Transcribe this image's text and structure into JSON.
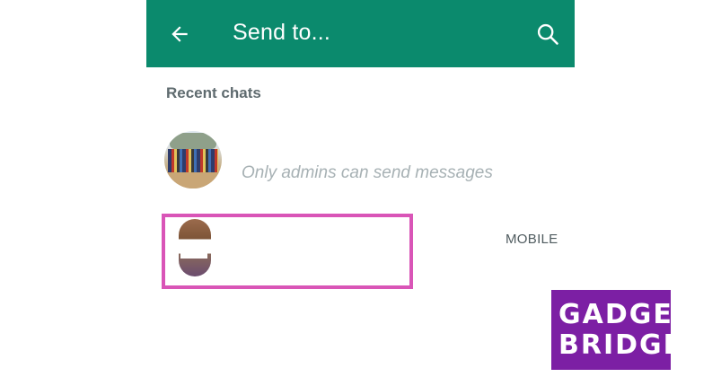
{
  "appbar": {
    "title": "Send to...",
    "back_icon": "arrow-left-icon",
    "search_icon": "search-icon",
    "color": "#0b8a6d"
  },
  "recent": {
    "header": "Recent chats",
    "chats": [
      {
        "subtitle": "Only admins can send messages",
        "avatar": "group-photo"
      },
      {
        "label": "MOBILE",
        "avatar": "contact-photo"
      }
    ]
  },
  "highlight_color": "#d955b7",
  "watermark": {
    "line1": "GADGET",
    "line2": "BRIDGE",
    "color": "#7c1fa4"
  }
}
